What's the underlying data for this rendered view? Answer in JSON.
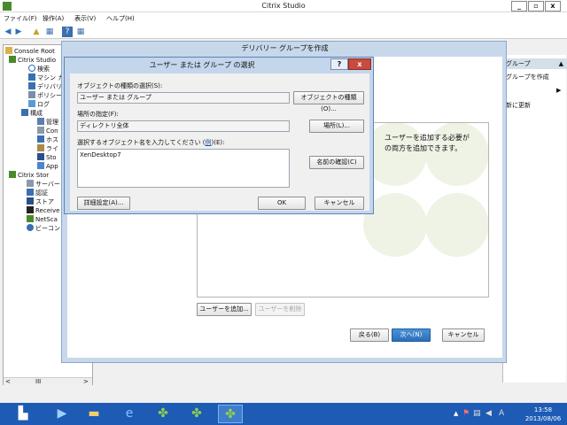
{
  "app_title": "Citrix Studio",
  "menus": [
    "ファイル(F)",
    "操作(A)",
    "表示(V)",
    "ヘルプ(H)"
  ],
  "tree": {
    "items": [
      "Console Root",
      "Citrix Studio",
      "検索",
      "マシン カ",
      "デリバリー",
      "ポリシー",
      "ログ",
      "構成",
      "管理",
      "Con",
      "ホス",
      "ライ",
      "Sto",
      "App",
      "Citrix Stor",
      "サーバー",
      "認証",
      "ストア",
      "Receive",
      "NetSca",
      "ビーコン"
    ],
    "scroll_label": "III"
  },
  "actions": {
    "header": "グループ",
    "items": [
      "グループを作成",
      "新に更新"
    ]
  },
  "wizard": {
    "title": "デリバリー グループを作成",
    "info_text_1": "ユーザーを追加する必要が",
    "info_text_2": "の両方を追加できます。",
    "add_user_button": "ユーザーを追加...",
    "remove_user_button": "ユーザーを削除",
    "back_button": "戻る(B)",
    "next_button": "次へ(N)",
    "cancel_button": "キャンセル"
  },
  "dialog": {
    "title": "ユーザー または グループ の選択",
    "help_button": "?",
    "close_button": "x",
    "object_type_label": "オブジェクトの種類の選択(S):",
    "object_type_value": "ユーザー または グループ",
    "object_type_button": "オブジェクトの種類(O)...",
    "location_label": "場所の指定(F):",
    "location_value": "ディレクトリ全体",
    "location_button": "場所(L)...",
    "names_label_prefix": "選択するオブジェクト名を入力してください (",
    "names_label_link": "例",
    "names_label_suffix": ")(E):",
    "names_value": "XenDesktop7",
    "check_names_button": "名前の確認(C)",
    "advanced_button": "詳細設定(A)...",
    "ok_button": "OK",
    "cancel_button": "キャンセル"
  },
  "taskbar": {
    "time": "13:58",
    "date": "2013/08/06"
  },
  "colors": {
    "accent": "#2a6fb8",
    "dialog_border": "#5f83b8",
    "taskbar": "#1d5bb5",
    "close_red": "#c74b3f"
  }
}
